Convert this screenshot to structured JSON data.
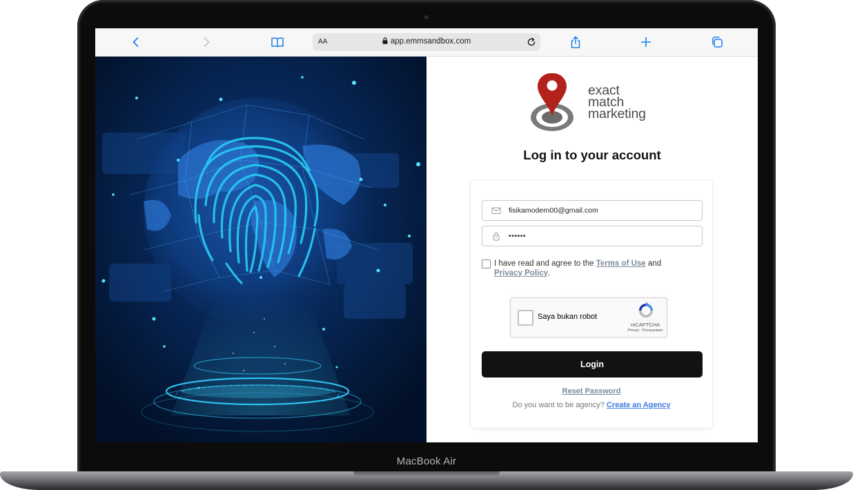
{
  "device": {
    "label": "MacBook Air"
  },
  "browser": {
    "text_size_label": "AA",
    "url": "app.emmsandbox.com",
    "icons": [
      "back-icon",
      "forward-icon",
      "bookmarks-icon",
      "lock-icon",
      "reload-icon",
      "share-icon",
      "new-tab-icon",
      "tabs-icon"
    ]
  },
  "logo": {
    "line1": "exact",
    "line2": "match",
    "line3": "marketing",
    "pin_color": "#b3221a",
    "ring_color": "#6b6b6b"
  },
  "login": {
    "heading": "Log in to your account",
    "email_value": "fisikamodern00@gmail.com",
    "password_value": "••••••",
    "agree_prefix": "I have read and agree to the ",
    "terms_label": "Terms of Use",
    "agree_and": " and",
    "privacy_label": "Privacy Policy",
    "agree_suffix": ".",
    "recaptcha_label": "Saya bukan robot",
    "recaptcha_brand": "reCAPTCHA",
    "recaptcha_terms": "Privasi · Persyaratan",
    "login_button": "Login",
    "reset_label": "Reset Password",
    "agency_question": "Do you want to be agency? ",
    "agency_link": "Create an Agency"
  },
  "colors": {
    "accent_link": "#3d7be0",
    "muted_link": "#7d8a99",
    "button": "#111213",
    "hero_bg": "#031733",
    "fingerprint": "#27c6f2"
  }
}
